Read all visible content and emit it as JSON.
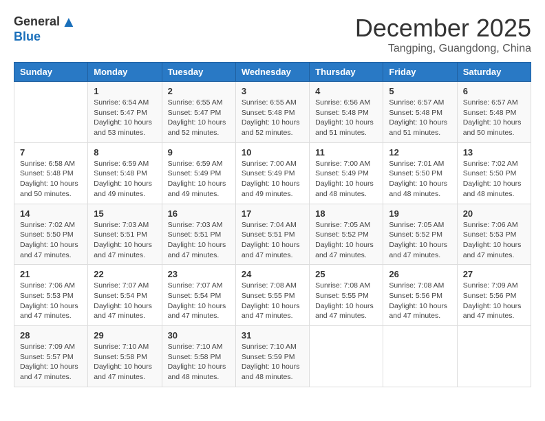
{
  "logo": {
    "general": "General",
    "blue": "Blue"
  },
  "title": "December 2025",
  "location": "Tangping, Guangdong, China",
  "days_of_week": [
    "Sunday",
    "Monday",
    "Tuesday",
    "Wednesday",
    "Thursday",
    "Friday",
    "Saturday"
  ],
  "weeks": [
    [
      {
        "day": "",
        "info": ""
      },
      {
        "day": "1",
        "info": "Sunrise: 6:54 AM\nSunset: 5:47 PM\nDaylight: 10 hours\nand 53 minutes."
      },
      {
        "day": "2",
        "info": "Sunrise: 6:55 AM\nSunset: 5:47 PM\nDaylight: 10 hours\nand 52 minutes."
      },
      {
        "day": "3",
        "info": "Sunrise: 6:55 AM\nSunset: 5:48 PM\nDaylight: 10 hours\nand 52 minutes."
      },
      {
        "day": "4",
        "info": "Sunrise: 6:56 AM\nSunset: 5:48 PM\nDaylight: 10 hours\nand 51 minutes."
      },
      {
        "day": "5",
        "info": "Sunrise: 6:57 AM\nSunset: 5:48 PM\nDaylight: 10 hours\nand 51 minutes."
      },
      {
        "day": "6",
        "info": "Sunrise: 6:57 AM\nSunset: 5:48 PM\nDaylight: 10 hours\nand 50 minutes."
      }
    ],
    [
      {
        "day": "7",
        "info": "Sunrise: 6:58 AM\nSunset: 5:48 PM\nDaylight: 10 hours\nand 50 minutes."
      },
      {
        "day": "8",
        "info": "Sunrise: 6:59 AM\nSunset: 5:48 PM\nDaylight: 10 hours\nand 49 minutes."
      },
      {
        "day": "9",
        "info": "Sunrise: 6:59 AM\nSunset: 5:49 PM\nDaylight: 10 hours\nand 49 minutes."
      },
      {
        "day": "10",
        "info": "Sunrise: 7:00 AM\nSunset: 5:49 PM\nDaylight: 10 hours\nand 49 minutes."
      },
      {
        "day": "11",
        "info": "Sunrise: 7:00 AM\nSunset: 5:49 PM\nDaylight: 10 hours\nand 48 minutes."
      },
      {
        "day": "12",
        "info": "Sunrise: 7:01 AM\nSunset: 5:50 PM\nDaylight: 10 hours\nand 48 minutes."
      },
      {
        "day": "13",
        "info": "Sunrise: 7:02 AM\nSunset: 5:50 PM\nDaylight: 10 hours\nand 48 minutes."
      }
    ],
    [
      {
        "day": "14",
        "info": "Sunrise: 7:02 AM\nSunset: 5:50 PM\nDaylight: 10 hours\nand 47 minutes."
      },
      {
        "day": "15",
        "info": "Sunrise: 7:03 AM\nSunset: 5:51 PM\nDaylight: 10 hours\nand 47 minutes."
      },
      {
        "day": "16",
        "info": "Sunrise: 7:03 AM\nSunset: 5:51 PM\nDaylight: 10 hours\nand 47 minutes."
      },
      {
        "day": "17",
        "info": "Sunrise: 7:04 AM\nSunset: 5:51 PM\nDaylight: 10 hours\nand 47 minutes."
      },
      {
        "day": "18",
        "info": "Sunrise: 7:05 AM\nSunset: 5:52 PM\nDaylight: 10 hours\nand 47 minutes."
      },
      {
        "day": "19",
        "info": "Sunrise: 7:05 AM\nSunset: 5:52 PM\nDaylight: 10 hours\nand 47 minutes."
      },
      {
        "day": "20",
        "info": "Sunrise: 7:06 AM\nSunset: 5:53 PM\nDaylight: 10 hours\nand 47 minutes."
      }
    ],
    [
      {
        "day": "21",
        "info": "Sunrise: 7:06 AM\nSunset: 5:53 PM\nDaylight: 10 hours\nand 47 minutes."
      },
      {
        "day": "22",
        "info": "Sunrise: 7:07 AM\nSunset: 5:54 PM\nDaylight: 10 hours\nand 47 minutes."
      },
      {
        "day": "23",
        "info": "Sunrise: 7:07 AM\nSunset: 5:54 PM\nDaylight: 10 hours\nand 47 minutes."
      },
      {
        "day": "24",
        "info": "Sunrise: 7:08 AM\nSunset: 5:55 PM\nDaylight: 10 hours\nand 47 minutes."
      },
      {
        "day": "25",
        "info": "Sunrise: 7:08 AM\nSunset: 5:55 PM\nDaylight: 10 hours\nand 47 minutes."
      },
      {
        "day": "26",
        "info": "Sunrise: 7:08 AM\nSunset: 5:56 PM\nDaylight: 10 hours\nand 47 minutes."
      },
      {
        "day": "27",
        "info": "Sunrise: 7:09 AM\nSunset: 5:56 PM\nDaylight: 10 hours\nand 47 minutes."
      }
    ],
    [
      {
        "day": "28",
        "info": "Sunrise: 7:09 AM\nSunset: 5:57 PM\nDaylight: 10 hours\nand 47 minutes."
      },
      {
        "day": "29",
        "info": "Sunrise: 7:10 AM\nSunset: 5:58 PM\nDaylight: 10 hours\nand 47 minutes."
      },
      {
        "day": "30",
        "info": "Sunrise: 7:10 AM\nSunset: 5:58 PM\nDaylight: 10 hours\nand 48 minutes."
      },
      {
        "day": "31",
        "info": "Sunrise: 7:10 AM\nSunset: 5:59 PM\nDaylight: 10 hours\nand 48 minutes."
      },
      {
        "day": "",
        "info": ""
      },
      {
        "day": "",
        "info": ""
      },
      {
        "day": "",
        "info": ""
      }
    ]
  ]
}
